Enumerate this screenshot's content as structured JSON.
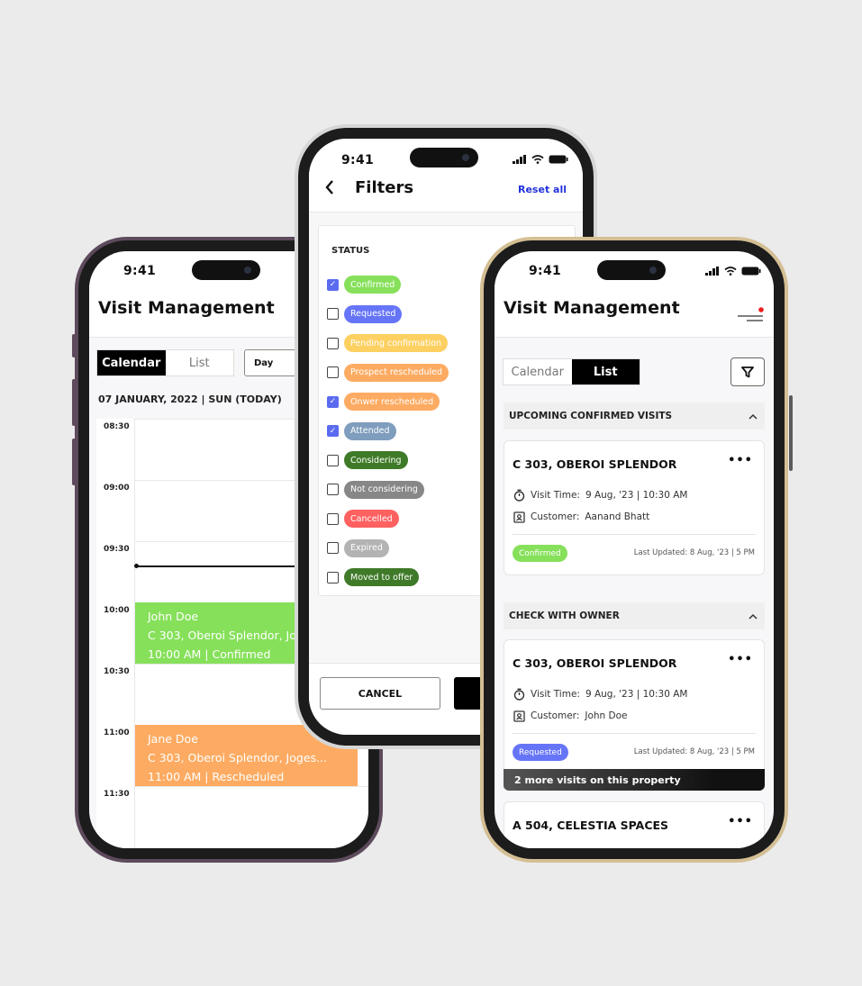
{
  "status_bar": {
    "time": "9:41"
  },
  "calendar_phone": {
    "title": "Visit Management",
    "view_toggle": {
      "calendar": "Calendar",
      "list": "List",
      "active": "Calendar"
    },
    "range_select": "Day",
    "date_label": "07 JANUARY, 2022 | SUN (TODAY)",
    "time_slots": [
      "08:30",
      "09:00",
      "09:30",
      "10:00",
      "10:30",
      "11:00",
      "11:30"
    ],
    "events": [
      {
        "name": "John Doe",
        "address": "C 303, Oberoi Splendor, Jogeshwari",
        "time_status": "10:00 AM  | Confirmed",
        "color": "#86e05a"
      },
      {
        "name": "Jane Doe",
        "address": "C 303, Oberoi Splendor, Joges...",
        "time_status": "11:00 AM  | Rescheduled",
        "color": "#fdab62"
      }
    ]
  },
  "filters_phone": {
    "title": "Filters",
    "reset_label": "Reset all",
    "section_label": "STATUS",
    "options": [
      {
        "label": "Confirmed",
        "checked": true,
        "color": "#86e05a"
      },
      {
        "label": "Requested",
        "checked": false,
        "color": "#6675f7"
      },
      {
        "label": "Pending confirmation",
        "checked": false,
        "color": "#fdd062"
      },
      {
        "label": "Prospect rescheduled",
        "checked": false,
        "color": "#fdab62"
      },
      {
        "label": "Onwer rescheduled",
        "checked": true,
        "color": "#fdab62"
      },
      {
        "label": "Attended",
        "checked": true,
        "color": "#7f9dbd"
      },
      {
        "label": "Considering",
        "checked": false,
        "color": "#3f7a28"
      },
      {
        "label": "Not considering",
        "checked": false,
        "color": "#878787"
      },
      {
        "label": "Cancelled",
        "checked": false,
        "color": "#ff6060"
      },
      {
        "label": "Expired",
        "checked": false,
        "color": "#b3b3b3"
      },
      {
        "label": "Moved to offer",
        "checked": false,
        "color": "#3f7a28"
      }
    ],
    "cancel_label": "CANCEL"
  },
  "list_phone": {
    "title": "Visit Management",
    "view_toggle": {
      "calendar": "Calendar",
      "list": "List",
      "active": "List"
    },
    "sections": [
      {
        "title": "UPCOMING CONFIRMED VISITS",
        "cards": [
          {
            "property": "C 303, OBEROI SPLENDOR",
            "visit_time_label": "Visit Time:",
            "visit_time": "9 Aug, '23 | 10:30 AM",
            "customer_label": "Customer:",
            "customer": "Aanand Bhatt",
            "status": "Confirmed",
            "status_color": "#86e05a",
            "last_updated": "Last Updated: 8 Aug, '23 | 5 PM"
          }
        ]
      },
      {
        "title": "CHECK WITH OWNER",
        "cards": [
          {
            "property": "C 303, OBEROI SPLENDOR",
            "visit_time_label": "Visit Time:",
            "visit_time": "9 Aug, '23 | 10:30 AM",
            "customer_label": "Customer:",
            "customer": "John Doe",
            "status": "Requested",
            "status_color": "#6675f7",
            "last_updated": "Last Updated: 8 Aug, '23 | 5 PM",
            "more_visits": "2 more visits on this property"
          },
          {
            "property": "A 504, CELESTIA SPACES"
          }
        ]
      }
    ]
  },
  "icons": {
    "back": "chevron-left-icon",
    "collapse": "chevron-up-icon",
    "more": "more-horizontal-icon",
    "timer": "stopwatch-icon",
    "customer": "id-badge-icon",
    "filter": "funnel-icon",
    "menu": "menu-with-notification-icon"
  }
}
